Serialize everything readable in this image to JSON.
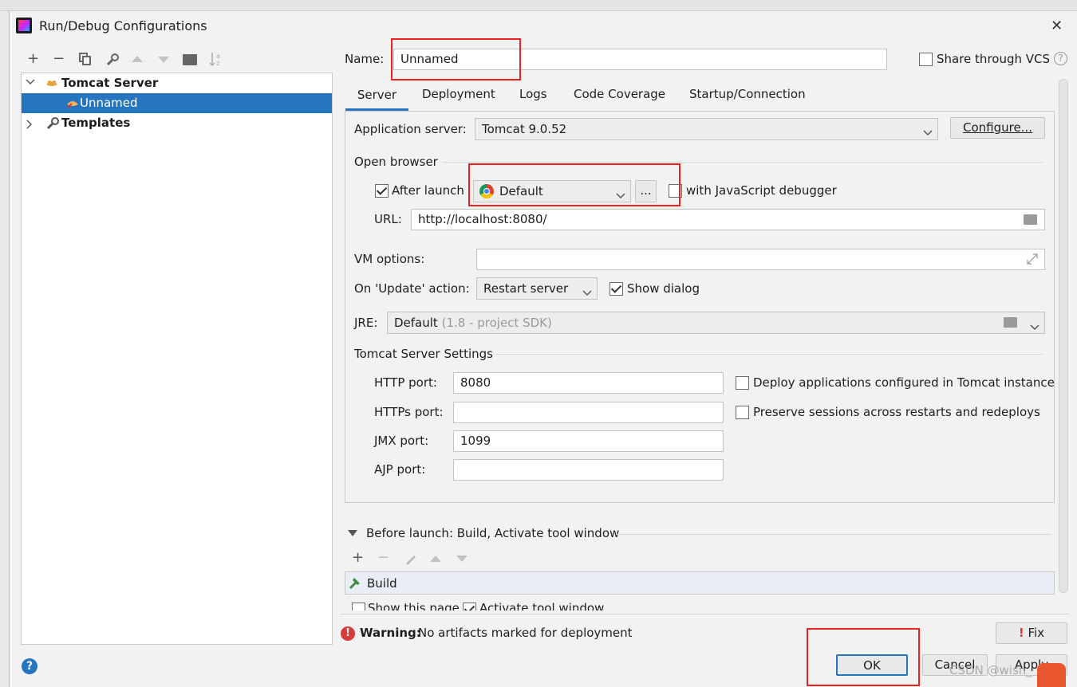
{
  "window": {
    "title": "Run/Debug Configurations",
    "close_label": "✕"
  },
  "toolbar": {
    "add": "+",
    "remove": "−"
  },
  "tree": {
    "group_label": "Tomcat Server",
    "child_label": "Unnamed",
    "templates_label": "Templates"
  },
  "name": {
    "label": "Name:",
    "value": "Unnamed"
  },
  "share": {
    "label": "Share through VCS",
    "checked": false
  },
  "tabs": [
    "Server",
    "Deployment",
    "Logs",
    "Code Coverage",
    "Startup/Connection"
  ],
  "server": {
    "app_server_label": "Application server:",
    "app_server_value": "Tomcat 9.0.52",
    "configure_label": "Configure...",
    "open_browser_label": "Open browser",
    "after_launch_label": "After launch",
    "browser_value": "Default",
    "browse_button": "...",
    "js_debugger_label": "with JavaScript debugger",
    "url_label": "URL:",
    "url_value": "http://localhost:8080/",
    "vm_options_label": "VM options:",
    "vm_options_value": "",
    "update_action_label": "On 'Update' action:",
    "update_action_value": "Restart server",
    "show_dialog_label": "Show dialog",
    "jre_label": "JRE:",
    "jre_value": "Default",
    "jre_hint": "(1.8 - project SDK)",
    "tomcat_settings_label": "Tomcat Server Settings",
    "http_port_label": "HTTP port:",
    "http_port_value": "8080",
    "https_port_label": "HTTPs port:",
    "https_port_value": "",
    "jmx_port_label": "JMX port:",
    "jmx_port_value": "1099",
    "ajp_port_label": "AJP port:",
    "ajp_port_value": "",
    "deploy_apps_label": "Deploy applications configured in Tomcat instance",
    "preserve_sessions_label": "Preserve sessions across restarts and redeploys"
  },
  "before_launch": {
    "label": "Before launch: Build, Activate tool window",
    "items": [
      "Build"
    ],
    "show_page_label": "Show this page",
    "activate_label": "Activate tool window"
  },
  "warning": {
    "bold": "Warning:",
    "text": "No artifacts marked for deployment",
    "fix_label": "Fix"
  },
  "buttons": {
    "ok": "OK",
    "cancel": "Cancel",
    "apply": "Apply"
  },
  "watermark": "CSDN @wish_",
  "colors": {
    "selection": "#2675bf",
    "highlight_box": "#f02020",
    "ok_border": "#2675bf"
  }
}
